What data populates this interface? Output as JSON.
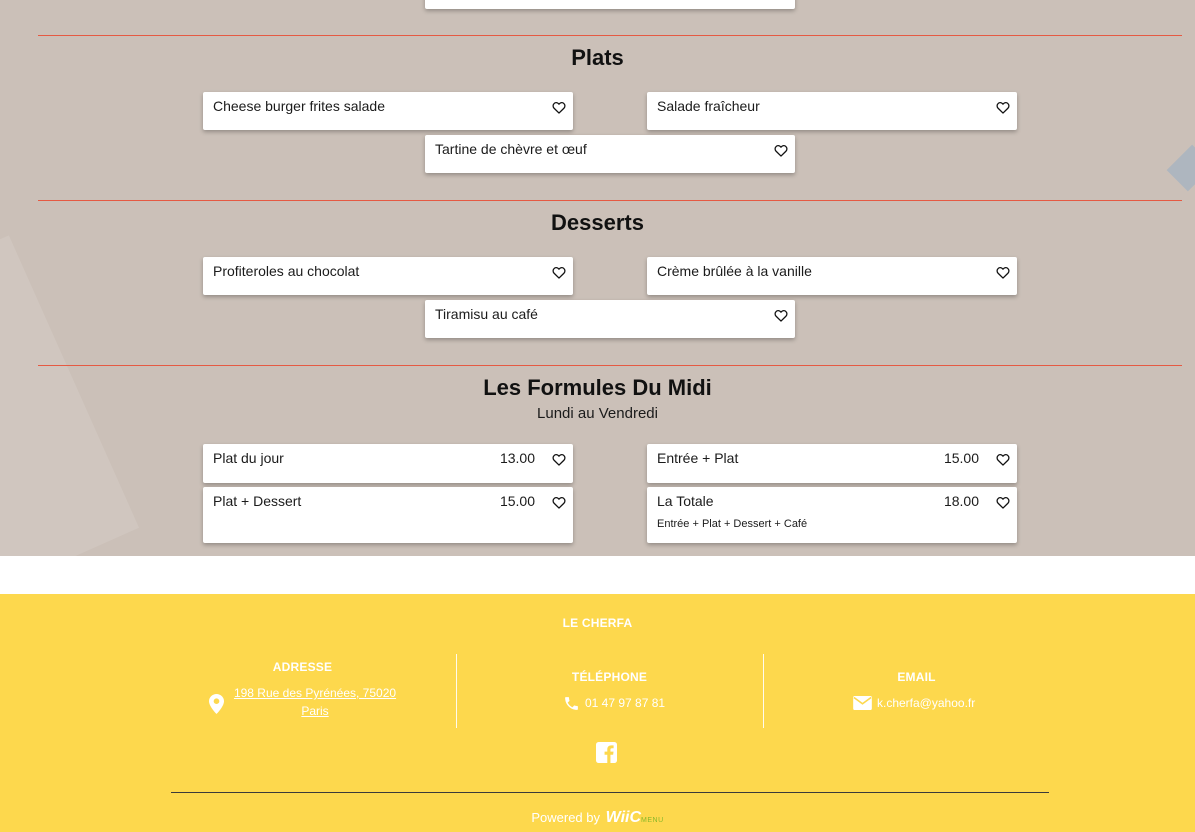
{
  "sections": {
    "plats": {
      "title": "Plats",
      "items": [
        "Cheese burger frites salade",
        "Salade fraîcheur",
        "Tartine de chèvre et œuf"
      ]
    },
    "desserts": {
      "title": "Desserts",
      "items": [
        "Profiteroles au chocolat",
        "Crème brûlée à la vanille",
        "Tiramisu au café"
      ]
    },
    "formules": {
      "title": "Les Formules Du Midi",
      "subtitle": "Lundi au Vendredi",
      "items": [
        {
          "name": "Plat du jour",
          "price": "13.00"
        },
        {
          "name": "Entrée + Plat",
          "price": "15.00"
        },
        {
          "name": "Plat + Dessert",
          "price": "15.00"
        },
        {
          "name": "La Totale",
          "price": "18.00",
          "description": "Entrée + Plat + Dessert + Café"
        }
      ]
    }
  },
  "footer": {
    "restaurant_name": "LE CHERFA",
    "address": {
      "title": "ADRESSE",
      "line1": "198 Rue des Pyrénées, 75020",
      "line2": "Paris"
    },
    "phone": {
      "title": "TÉLÉPHONE",
      "value": "01 47 97 87 81"
    },
    "email": {
      "title": "EMAIL",
      "value": "k.cherfa@yahoo.fr"
    },
    "powered_by": "Powered by",
    "brand_main": "WiiC",
    "brand_sub": "MENU"
  },
  "colors": {
    "background": "#cbc0b8",
    "divider": "#e55a43",
    "footer": "#fdd84d",
    "brand_accent": "#8ab82a"
  },
  "icons": [
    "heart-icon",
    "location-pin-icon",
    "phone-icon",
    "envelope-icon",
    "facebook-icon"
  ]
}
